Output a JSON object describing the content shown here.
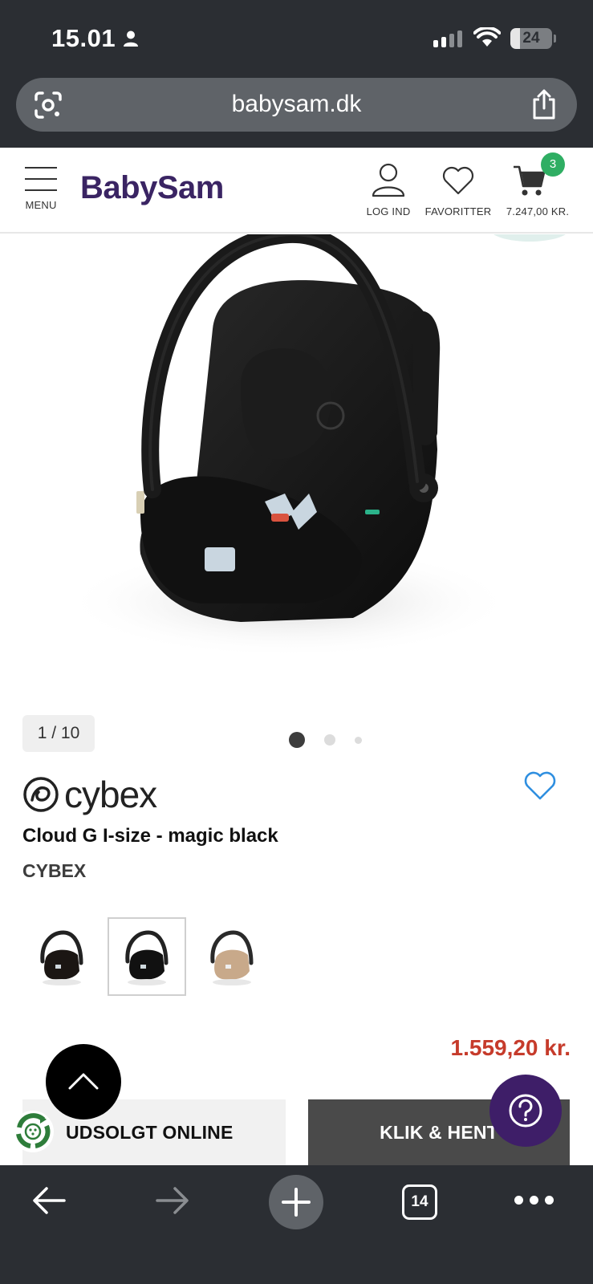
{
  "status_bar": {
    "time": "15.01",
    "battery_level": "24",
    "battery_fraction": 0.24
  },
  "browser": {
    "url": "babysam.dk",
    "open_tabs": "14"
  },
  "site_header": {
    "logo": "BabySam",
    "menu_label": "MENU",
    "login_label": "LOG IND",
    "favorites_label": "FAVORITTER",
    "cart_total": "7.247,00 KR.",
    "cart_count": "3"
  },
  "gallery": {
    "counter": "1 / 10",
    "active_dot": 0,
    "dot_count": 3
  },
  "product": {
    "brand_logo": "cybex",
    "title": "Cloud G I-size - magic black",
    "brand": "CYBEX",
    "price": "1.559,20 kr.",
    "variants": [
      {
        "name": "black",
        "selected": false
      },
      {
        "name": "magic black",
        "selected": true
      },
      {
        "name": "beige",
        "selected": false
      }
    ]
  },
  "actions": {
    "soldout_label": "UDSOLGT ONLINE",
    "click_collect_label": "KLIK & HENT"
  },
  "colors": {
    "brand_purple": "#3a2463",
    "price_red": "#c63b2b",
    "cart_badge_green": "#2fae63",
    "help_button": "#3e1e68",
    "wishlist_blue": "#2f8fe0"
  }
}
